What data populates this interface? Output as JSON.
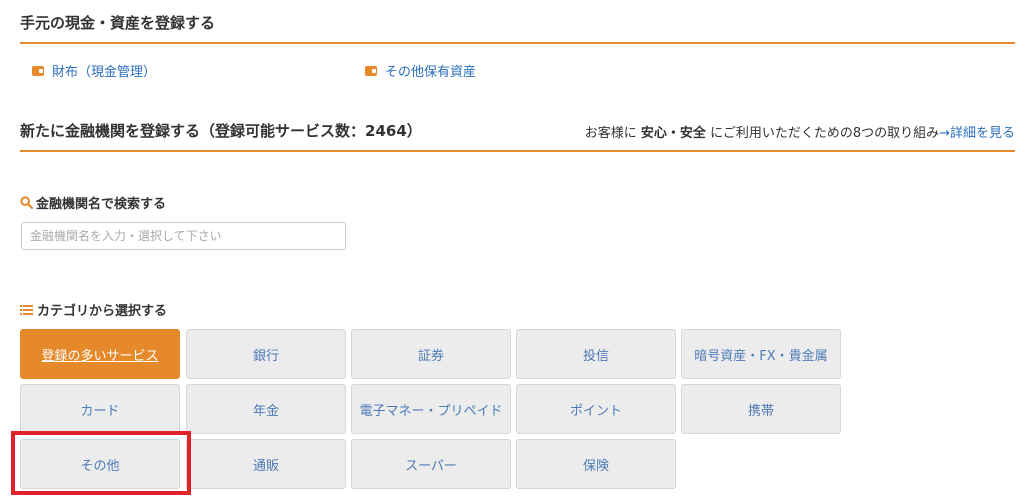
{
  "asset_section": {
    "title": "手元の現金・資産を登録する",
    "wallet_label": "財布（現金管理）",
    "other_assets_label": "その他保有資産"
  },
  "institution_section": {
    "title": "新たに金融機関を登録する（登録可能サービス数：2464）",
    "note_prefix": "お客様に",
    "note_bold": "安心・安全",
    "note_middle": "にご利用いただくための8つの取り組み",
    "note_link": "→詳細を見る"
  },
  "search": {
    "heading": "金融機関名で検索する",
    "placeholder": "金融機関名を入力・選択して下さい"
  },
  "categories": {
    "heading": "カテゴリから選択する",
    "items": [
      "登録の多いサービス",
      "銀行",
      "証券",
      "投信",
      "暗号資産・FX・貴金属",
      "カード",
      "年金",
      "電子マネー・プリペイド",
      "ポイント",
      "携帯",
      "その他",
      "通販",
      "スーパー",
      "保険"
    ],
    "active_index": 0,
    "highlighted_index": 10
  },
  "colors": {
    "accent": "#e5892a",
    "link": "#2a6ebd",
    "button_text": "#4d7ab8",
    "highlight": "#e0222a"
  }
}
